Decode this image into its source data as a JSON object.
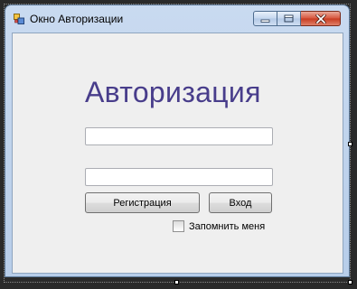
{
  "window": {
    "title": "Окно Авторизации",
    "heading": "Авторизация"
  },
  "form": {
    "login_value": "",
    "password_value": "",
    "register_label": "Регистрация",
    "login_label": "Вход",
    "remember_label": "Запомнить меня",
    "remember_checked": false
  },
  "icons": {
    "app": "form-app-icon",
    "minimize": "minimize-icon",
    "maximize": "maximize-icon",
    "close": "close-icon"
  },
  "colors": {
    "heading": "#483d8b",
    "client_background": "#efefef",
    "close_button": "#c73a1f"
  }
}
